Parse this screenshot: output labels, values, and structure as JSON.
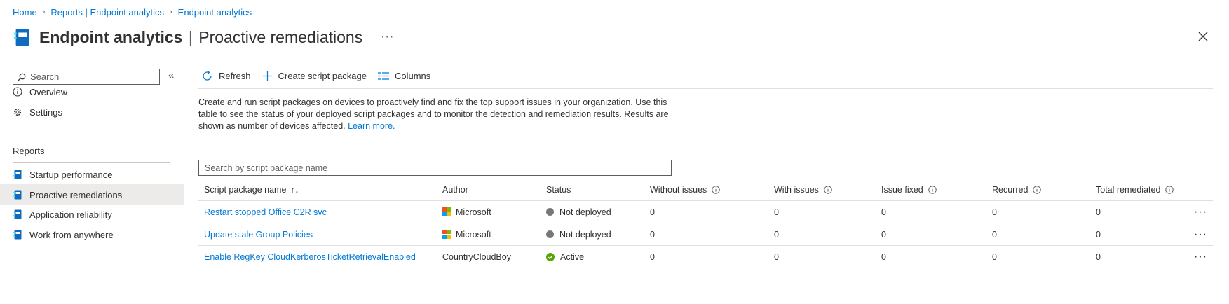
{
  "breadcrumb": [
    "Home",
    "Reports | Endpoint analytics",
    "Endpoint analytics"
  ],
  "header": {
    "title_bold": "Endpoint analytics",
    "pipe": "|",
    "title_rest": "Proactive remediations",
    "more": "···"
  },
  "sidebar": {
    "search_placeholder": "Search",
    "collapse_glyph": "«",
    "top_items": [
      {
        "label": "Overview",
        "icon": "info-icon"
      },
      {
        "label": "Settings",
        "icon": "gear-icon"
      }
    ],
    "section_label": "Reports",
    "report_items": [
      {
        "label": "Startup performance",
        "icon": "report-book-icon"
      },
      {
        "label": "Proactive remediations",
        "icon": "report-book-icon",
        "selected": true
      },
      {
        "label": "Application reliability",
        "icon": "report-book-icon"
      },
      {
        "label": "Work from anywhere",
        "icon": "report-book-icon"
      }
    ]
  },
  "toolbar": {
    "refresh": "Refresh",
    "create": "Create script package",
    "columns": "Columns"
  },
  "description": {
    "text": "Create and run script packages on devices to proactively find and fix the top support issues in your organization. Use this table to see the status of your deployed script packages and to monitor the detection and remediation results. Results are shown as number of devices affected.",
    "link": "Learn more."
  },
  "table": {
    "search_placeholder": "Search by script package name",
    "sort_glyph": "↑↓",
    "columns": [
      "Script package name",
      "Author",
      "Status",
      "Without issues",
      "With issues",
      "Issue fixed",
      "Recurred",
      "Total remediated"
    ],
    "rows": [
      {
        "name": "Restart stopped Office C2R svc",
        "author": "Microsoft",
        "status": "Not deployed",
        "without": "0",
        "with": "0",
        "fixed": "0",
        "recurred": "0",
        "total": "0"
      },
      {
        "name": "Update stale Group Policies",
        "author": "Microsoft",
        "status": "Not deployed",
        "without": "0",
        "with": "0",
        "fixed": "0",
        "recurred": "0",
        "total": "0"
      },
      {
        "name": "Enable RegKey CloudKerberosTicketRetrievalEnabled",
        "author": "CountryCloudBoy",
        "status": "Active",
        "without": "0",
        "with": "0",
        "fixed": "0",
        "recurred": "0",
        "total": "0"
      }
    ],
    "row_more": "···"
  },
  "colors": {
    "link": "#0078d4",
    "selected_bg": "#edebe9",
    "active": "#57a300",
    "not_deployed": "#797775"
  }
}
